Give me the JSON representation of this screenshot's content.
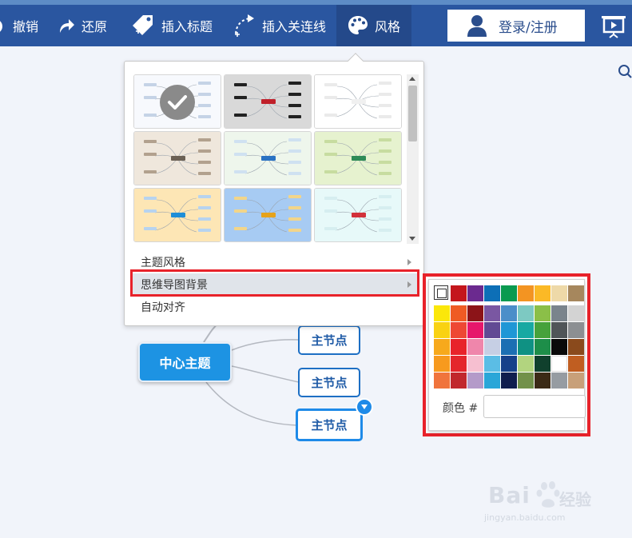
{
  "toolbar": {
    "undo_label": "撤销",
    "redo_label": "还原",
    "insert_topic_label": "插入标题",
    "insert_relation_label": "插入关连线",
    "style_label": "风格",
    "login_label": "登录/注册"
  },
  "mindmap": {
    "center_label": "中心主题",
    "nodes": [
      "主节点",
      "主节点",
      "主节点"
    ]
  },
  "style_menu": {
    "theme_style_label": "主题风格",
    "background_label": "思维导图背景",
    "auto_align_label": "自动对齐",
    "thumbnails": [
      {
        "bg": "#f7f9fd",
        "node": "#c5d3e6",
        "center": "#d8e3f1",
        "selected": true
      },
      {
        "bg": "#d9d9d9",
        "node": "#222222",
        "center": "#c0202a",
        "selected": false
      },
      {
        "bg": "#ffffff",
        "node": "#eaeaea",
        "center": "#f0f0f0",
        "selected": false
      },
      {
        "bg": "#efe7dc",
        "node": "#b2a18e",
        "center": "#6b6155",
        "selected": false
      },
      {
        "bg": "#eef6ec",
        "node": "#cfe1f1",
        "center": "#2a72c3",
        "selected": false
      },
      {
        "bg": "#e6f2cf",
        "node": "#c7dca0",
        "center": "#2e8b57",
        "selected": false
      },
      {
        "bg": "#fde6b5",
        "node": "#b7d3ef",
        "center": "#1d8ed8",
        "selected": false
      },
      {
        "bg": "#a7cbf3",
        "node": "#f2d58a",
        "center": "#e6a21a",
        "selected": false
      },
      {
        "bg": "#e7f9f9",
        "node": "#d6eef0",
        "center": "#d2303a",
        "selected": false
      }
    ]
  },
  "color_picker": {
    "color_label": "颜色 #",
    "hex_value": "",
    "swatches": [
      [
        "#c4161c",
        "#6b2a8f",
        "#0d6fb7",
        "#0a9a50",
        "#f39422",
        "#fbb926",
        "#eed9a8",
        "#a6875d"
      ],
      [
        "#fbe70a",
        "#ef5b24",
        "#8c1418",
        "#7a57a2",
        "#4b8ec9",
        "#7dc9c2",
        "#8bbf48",
        "#7a848c",
        "#d3d3d3"
      ],
      [
        "#f9d212",
        "#ee4834",
        "#e6176b",
        "#624a94",
        "#1f97d6",
        "#17a9a2",
        "#46a23b",
        "#505558",
        "#8c8f92"
      ],
      [
        "#f7a91c",
        "#e8232a",
        "#ef86ab",
        "#c6cfe4",
        "#1b6fb3",
        "#0f9183",
        "#1d8e49",
        "#0a0a0a",
        "#8a4a1c"
      ],
      [
        "#f79a1e",
        "#e4262c",
        "#f6bfd0",
        "#5bbde5",
        "#16418a",
        "#b2d47f",
        "#10402d",
        "#ffffff",
        "#c05e21"
      ],
      [
        "#f0743c",
        "#c1272d",
        "#b49ac9",
        "#2aa6d8",
        "#0f1d4e",
        "#72914a",
        "#3b2a16",
        "#969ca2",
        "#c8a079"
      ]
    ]
  }
}
